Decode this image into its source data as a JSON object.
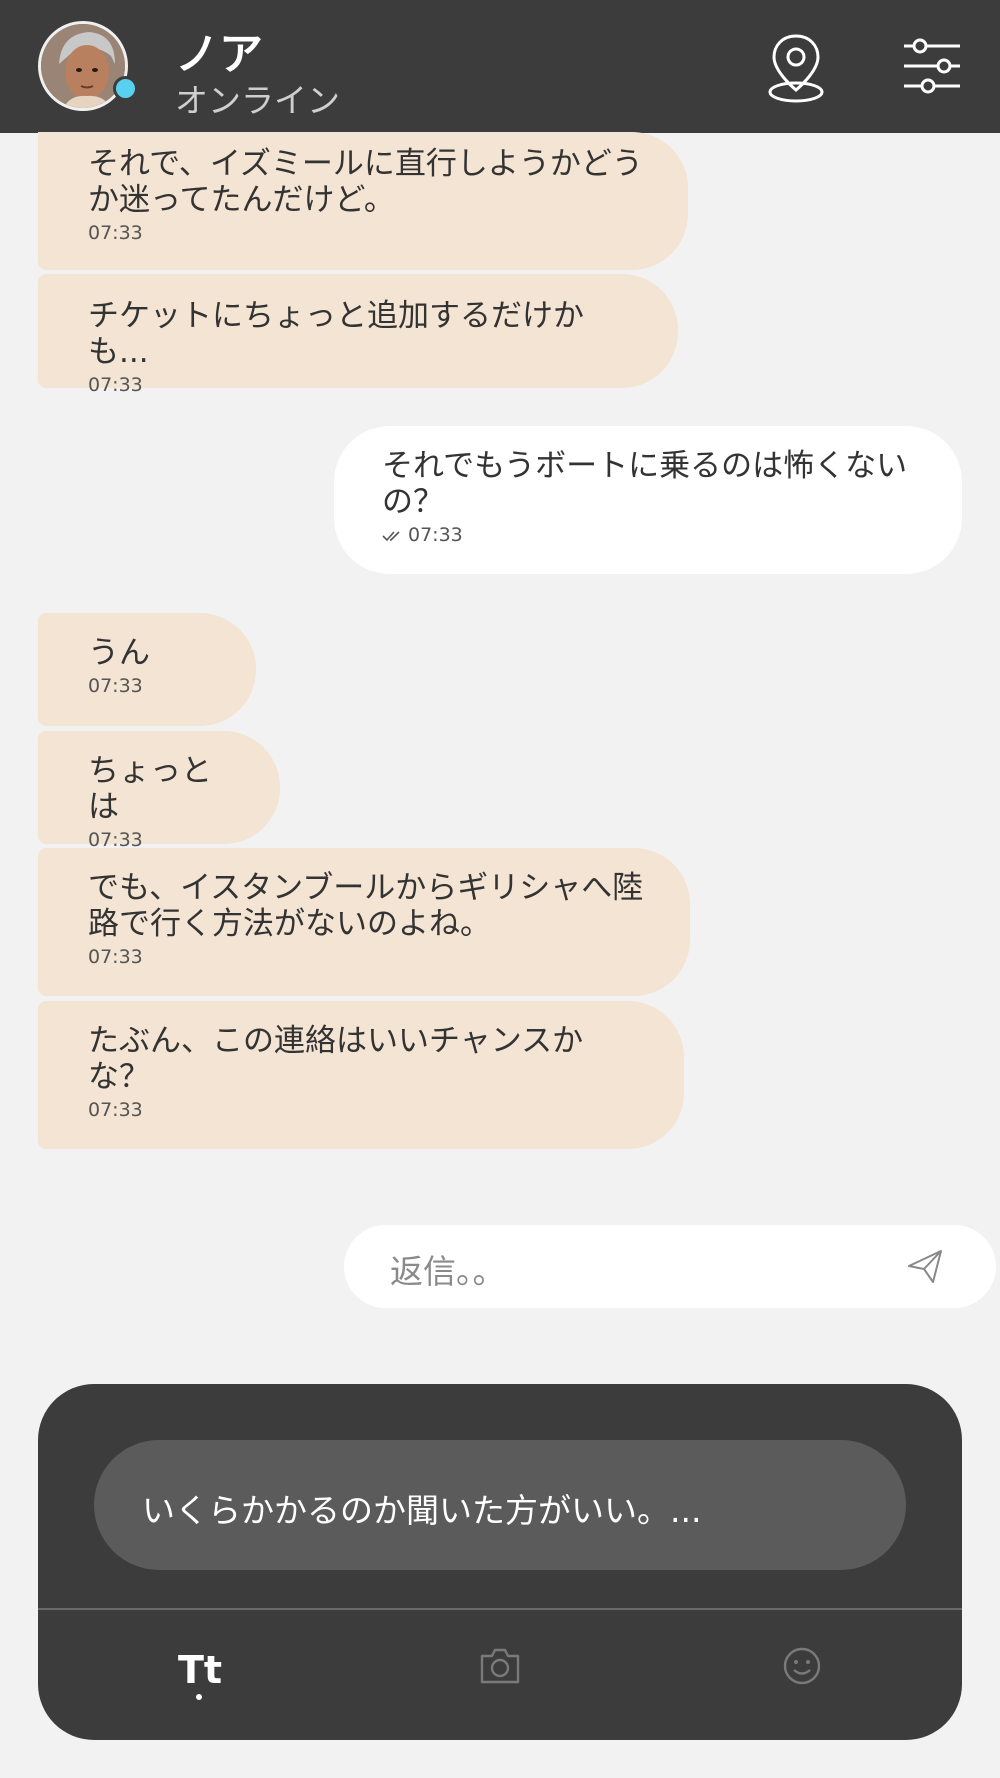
{
  "header": {
    "name": "ノア",
    "status": "オンライン",
    "location_icon": "map-pin-icon",
    "settings_icon": "sliders-icon",
    "online_color": "#5ad0f0"
  },
  "messages": [
    {
      "dir": "in",
      "text": "それで、イズミールに直行しようかどうか迷ってたんだけど。",
      "time": "07:33"
    },
    {
      "dir": "in",
      "text": "チケットにちょっと追加するだけかも...",
      "time": "07:33"
    },
    {
      "dir": "out",
      "text": "それでもうボートに乗るのは怖くないの？",
      "time": "07:33"
    },
    {
      "dir": "in",
      "text": "うん",
      "time": "07:33"
    },
    {
      "dir": "in",
      "text": "ちょっとは",
      "time": "07:33"
    },
    {
      "dir": "in",
      "text": "でも、イスタンブールからギリシャへ陸路で行く方法がないのよね。",
      "time": "07:33"
    },
    {
      "dir": "in",
      "text": "たぶん、この連絡はいいチャンスかな？",
      "time": "07:33"
    }
  ],
  "reply": {
    "placeholder": "返信。。"
  },
  "suggestion": {
    "text": "いくらかかるのか聞いた方がいい。..."
  },
  "toolbar": {
    "text_tab": "Tt",
    "camera_icon": "camera-icon",
    "emoji_icon": "smiley-icon"
  },
  "colors": {
    "header_bg": "#3c3c3c",
    "incoming_bubble": "#f3e4d3",
    "outgoing_bubble": "#ffffff",
    "background": "#f2f2f2"
  }
}
